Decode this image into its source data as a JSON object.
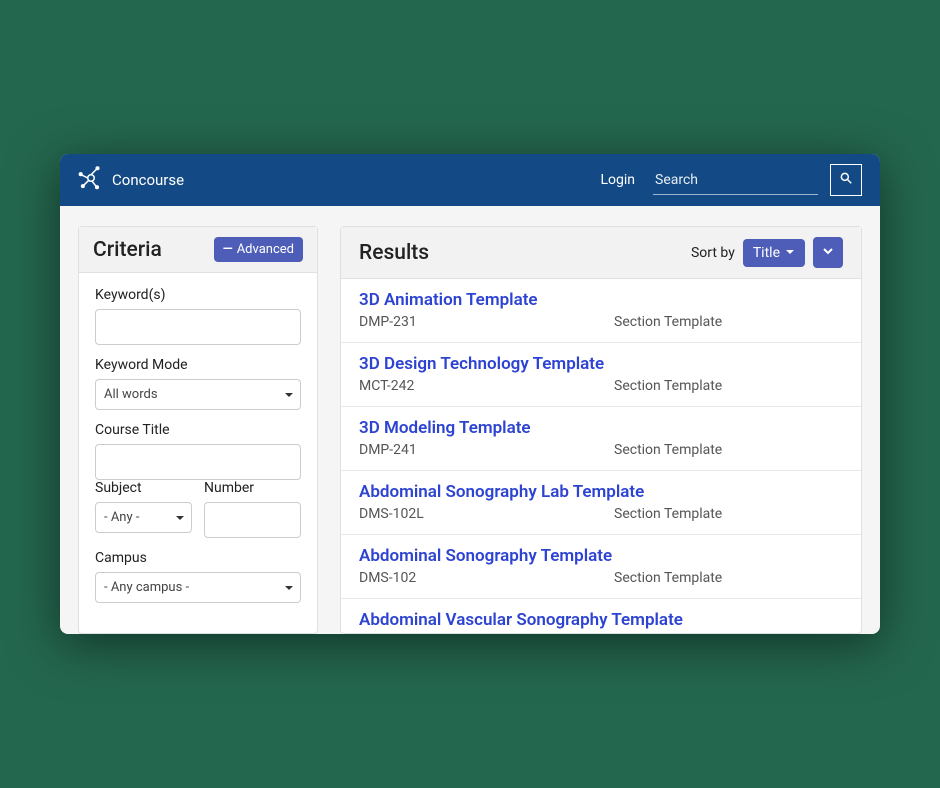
{
  "header": {
    "app_title": "Concourse",
    "login_label": "Login",
    "search_placeholder": "Search"
  },
  "criteria": {
    "title": "Criteria",
    "advanced_label": "Advanced",
    "keywords_label": "Keyword(s)",
    "keywords_value": "",
    "keyword_mode_label": "Keyword Mode",
    "keyword_mode_value": "All words",
    "course_title_label": "Course Title",
    "course_title_value": "",
    "subject_label": "Subject",
    "subject_value": "- Any -",
    "number_label": "Number",
    "number_value": "",
    "campus_label": "Campus",
    "campus_value": "- Any campus -"
  },
  "results": {
    "title": "Results",
    "sort_by_label": "Sort by",
    "sort_value": "Title",
    "items": [
      {
        "title": "3D Animation Template",
        "code": "DMP-231",
        "type": "Section Template"
      },
      {
        "title": "3D Design Technology Template",
        "code": "MCT-242",
        "type": "Section Template"
      },
      {
        "title": "3D Modeling Template",
        "code": "DMP-241",
        "type": "Section Template"
      },
      {
        "title": "Abdominal Sonography Lab Template",
        "code": "DMS-102L",
        "type": "Section Template"
      },
      {
        "title": "Abdominal Sonography Template",
        "code": "DMS-102",
        "type": "Section Template"
      },
      {
        "title": "Abdominal Vascular Sonography Template",
        "code": "",
        "type": ""
      }
    ]
  }
}
